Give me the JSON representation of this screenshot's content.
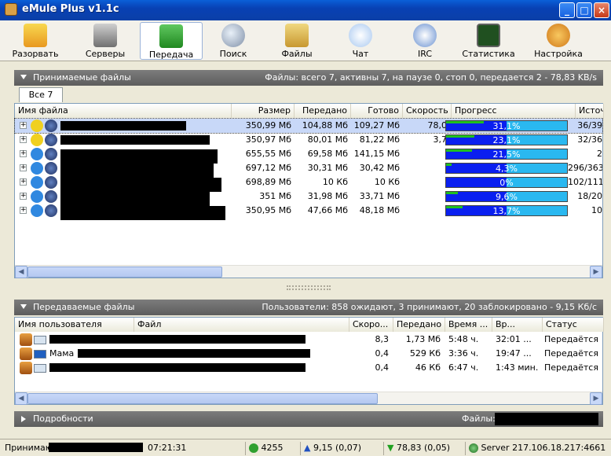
{
  "window": {
    "title": "eMule Plus v1.1c",
    "minimize": "_",
    "maximize": "□",
    "close": "×"
  },
  "toolbar": [
    {
      "label": "Разорвать",
      "icon": "disconnect-icon"
    },
    {
      "label": "Серверы",
      "icon": "servers-icon"
    },
    {
      "label": "Передача",
      "icon": "transfer-icon"
    },
    {
      "label": "Поиск",
      "icon": "search-icon"
    },
    {
      "label": "Файлы",
      "icon": "files-icon"
    },
    {
      "label": "Чат",
      "icon": "chat-icon"
    },
    {
      "label": "IRC",
      "icon": "irc-icon"
    },
    {
      "label": "Статистика",
      "icon": "statistics-icon"
    },
    {
      "label": "Настройка",
      "icon": "settings-icon"
    }
  ],
  "downloads": {
    "title": "Принимаемые файлы",
    "info": "Файлы: всего 7, активны 7, на паузе 0, стоп 0, передается 2 - 78,83 KB/s",
    "tab": "Все 7",
    "columns": [
      "Имя файла",
      "Размер",
      "Передано",
      "Готово",
      "Скорость",
      "Прогресс",
      "Источ..."
    ],
    "rows": [
      {
        "size": "350,99 Мб",
        "transferred": "104,88 Мб",
        "done": "109,27 Мб",
        "speed": "78,0",
        "progress": "31,1%",
        "progress_value": 0.311,
        "sources": "36/39",
        "selected": true
      },
      {
        "size": "350,97 Мб",
        "transferred": "80,01 Мб",
        "done": "81,22 Мб",
        "speed": "3,7",
        "progress": "23,1%",
        "progress_value": 0.231,
        "sources": "32/36",
        "selected": false
      },
      {
        "size": "655,55 Мб",
        "transferred": "69,58 Мб",
        "done": "141,15 Мб",
        "speed": "",
        "progress": "21,5%",
        "progress_value": 0.215,
        "sources": "2",
        "selected": false
      },
      {
        "size": "697,12 Мб",
        "transferred": "30,31 Мб",
        "done": "30,42 Мб",
        "speed": "",
        "progress": "4,3%",
        "progress_value": 0.043,
        "sources": "296/363",
        "selected": false
      },
      {
        "size": "698,89 Мб",
        "transferred": "10 Кб",
        "done": "10 Кб",
        "speed": "",
        "progress": "0%",
        "progress_value": 0.0,
        "sources": "102/111",
        "selected": false
      },
      {
        "size": "351 Мб",
        "transferred": "31,98 Мб",
        "done": "33,71 Мб",
        "speed": "",
        "progress": "9,6%",
        "progress_value": 0.096,
        "sources": "18/20",
        "selected": false
      },
      {
        "size": "350,95 Мб",
        "transferred": "47,66 Мб",
        "done": "48,18 Мб",
        "speed": "",
        "progress": "13,7%",
        "progress_value": 0.137,
        "sources": "10",
        "selected": false
      }
    ]
  },
  "uploads": {
    "title": "Передаваемые файлы",
    "info": "Пользователи: 858 ожидают, 3 принимают, 20 заблокировано - 9,15 Кб/с",
    "columns": [
      "Имя пользователя",
      "Файл",
      "Скоро...",
      "Передано",
      "Время ...",
      "Вр...",
      "Статус"
    ],
    "rows": [
      {
        "user": "",
        "speed": "8,3",
        "transferred": "1,73 Мб",
        "time": "5:48 ч.",
        "time2": "32:01 ...",
        "status": "Передаётся"
      },
      {
        "user": "Мама",
        "speed": "0,4",
        "transferred": "529 Кб",
        "time": "3:36 ч.",
        "time2": "19:47 ...",
        "status": "Передаётся"
      },
      {
        "user": "",
        "speed": "0,4",
        "transferred": "46 Кб",
        "time": "6:47 ч.",
        "time2": "1:43 мин.",
        "status": "Передаётся"
      }
    ]
  },
  "details": {
    "title": "Подробности",
    "files_label": "Файлы:"
  },
  "statusbar": {
    "status": "Принимаю",
    "time": "07:21:31",
    "users": "4255",
    "upload": "9,15 (0,07)",
    "download": "78,83 (0,05)",
    "server": "Server 217.106.18.217:4661"
  },
  "colors": {
    "progress_blue": "#0a1ff0",
    "progress_light": "#2ab8f0",
    "header_gray": "#6b6b6b",
    "selected_row": "#c8d8f8"
  }
}
